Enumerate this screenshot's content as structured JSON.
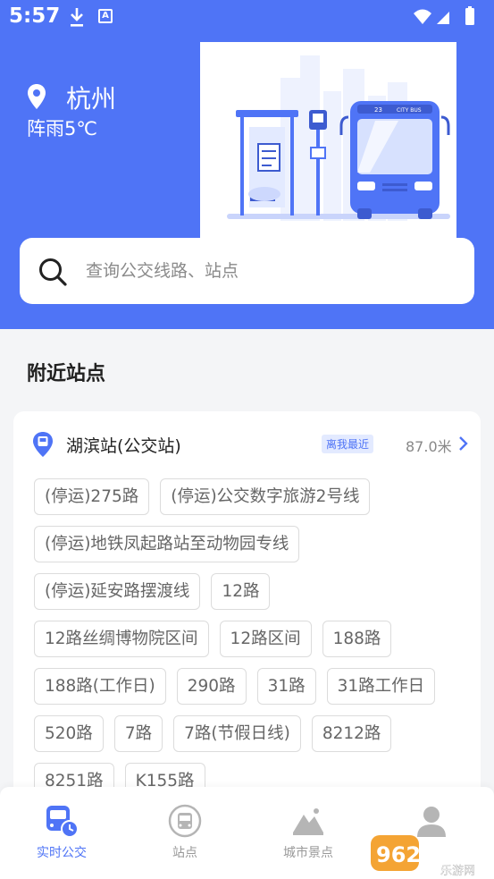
{
  "status_bar": {
    "time": "5:57",
    "download_icon": "download-icon",
    "app_badge": "A"
  },
  "location": {
    "city": "杭州",
    "weather": "阵雨5℃"
  },
  "illustration": {
    "bus_sign": "23",
    "bus_label": "CITY BUS"
  },
  "search": {
    "placeholder": "查询公交线路、站点"
  },
  "nearby": {
    "title": "附近站点",
    "stop": {
      "name": "湖滨站(公交站)",
      "badge": "离我最近",
      "distance": "87.0米"
    },
    "routes": [
      "(停运)275路",
      "(停运)公交数字旅游2号线",
      "(停运)地铁凤起路站至动物园专线",
      "(停运)延安路摆渡线",
      "12路",
      "12路丝绸博物院区间",
      "12路区间",
      "188路",
      "188路(工作日)",
      "290路",
      "31路",
      "31路工作日",
      "520路",
      "7路",
      "7路(节假日线)",
      "8212路",
      "8251路",
      "K155路"
    ]
  },
  "tabs": [
    {
      "label": "实时公交",
      "icon": "bus-clock-icon",
      "active": true
    },
    {
      "label": "站点",
      "icon": "bus-stop-icon",
      "active": false
    },
    {
      "label": "城市景点",
      "icon": "mountain-icon",
      "active": false
    },
    {
      "label": "",
      "icon": "user-icon",
      "active": false
    }
  ],
  "watermark": {
    "text": "962.NET",
    "subtext": "乐游网"
  },
  "colors": {
    "primary": "#4f74f6",
    "background": "#f4f5f7",
    "chip_border": "#dcdcdc"
  }
}
